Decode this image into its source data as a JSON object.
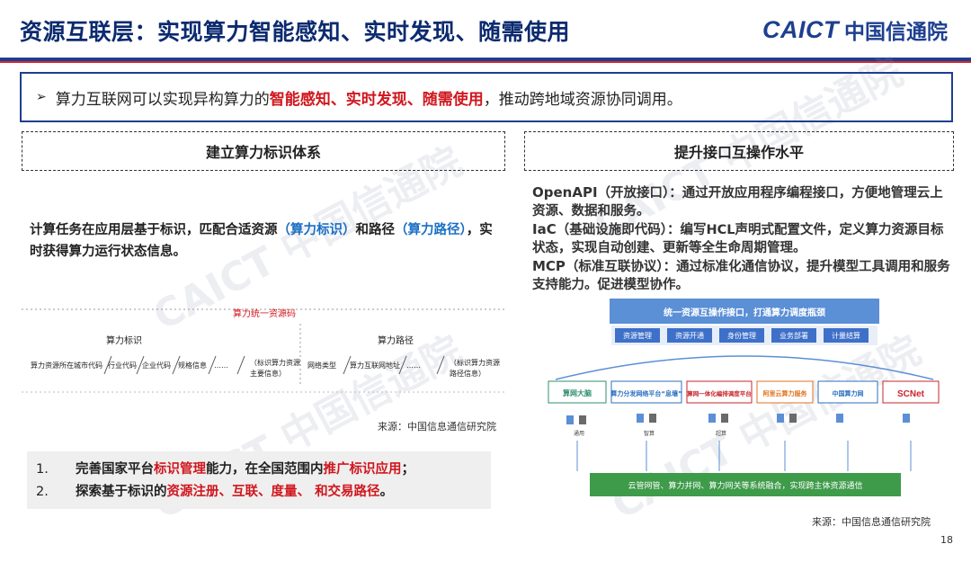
{
  "header": {
    "title": "资源互联层：实现算力智能感知、实时发现、随需使用",
    "logo_en": "CAICT",
    "logo_cn": "中国信通院"
  },
  "summary": {
    "arrow": "➢",
    "pre": "算力互联网可以实现异构算力的",
    "highlight": "智能感知、实时发现、随需使用",
    "post": "，推动跨地域资源协同调用。"
  },
  "left": {
    "heading": "建立算力标识体系",
    "desc": {
      "p1": "计算任务在应用层基于标识，匹配合适资源",
      "b1": "（算力标识）",
      "p2": "和路径",
      "b2": "（算力路径）",
      "p3": "，实时获得算力运行状态信息。"
    },
    "diagram": {
      "center_label": "算力统一资源码",
      "left_title": "算力标识",
      "right_title": "算力路径",
      "left_items": [
        "算力资源所在城市代码",
        "行业代码",
        "企业代码",
        "规格信息",
        "……",
        "（标识算力资源",
        "主要信息）"
      ],
      "right_items": [
        "网络类型",
        "算力互联网地址",
        "……",
        "（标识算力资源",
        "路径信息）"
      ]
    },
    "source": "来源：中国信息通信研究院",
    "list": [
      {
        "num": "1.",
        "p1": "完善国家平台",
        "r1": "标识管理",
        "p2": "能力，在全国范围内",
        "r2": "推广标识应用",
        "p3": "；"
      },
      {
        "num": "2.",
        "p1": "探索基于标识的",
        "r1": "资源注册、互联、度量、",
        "p2": " ",
        "r2": "和交易路径",
        "p3": "。"
      }
    ]
  },
  "right": {
    "heading": "提升接口互操作水平",
    "items": [
      {
        "lead": "OpenAPI",
        "text": "（开放接口）：通过开放应用程序编程接口，方便地管理云上资源、数据和服务。"
      },
      {
        "lead": "IaC",
        "text": "（基础设施即代码）：编写HCL声明式配置文件，定义算力资源目标状态，实现自动创建、更新等全生命周期管理。"
      },
      {
        "lead": "MCP",
        "text": "（标准互联协议）：通过标准化通信协议，提升模型工具调用和服务支持能力。促进模型协作。"
      }
    ],
    "arch": {
      "top_title": "统一资源互操作接口，打通算力调度瓶颈",
      "buttons": [
        "资源管理",
        "资源开通",
        "身份管理",
        "业务部署",
        "计量结算"
      ],
      "platforms": [
        "算网大脑",
        "算力分发网络平台“息壤”",
        "算网一体化编排调度平台",
        "阿里云算力服务",
        "中国算力网",
        "SCNet"
      ],
      "bottom_bar": "云管网管、算力并网、算力网关等系统融合，实现跨主体资源通信",
      "sub_labels": [
        "通用",
        "智算",
        "超算"
      ]
    },
    "source": "来源：中国信息通信研究院"
  },
  "page_number": "18",
  "colors": {
    "brand_blue": "#1d3f8f",
    "accent_red": "#d0161d",
    "link_blue": "#1a6fc4",
    "arch_blue": "#5b8fd6",
    "arch_green": "#3e9b4a"
  }
}
